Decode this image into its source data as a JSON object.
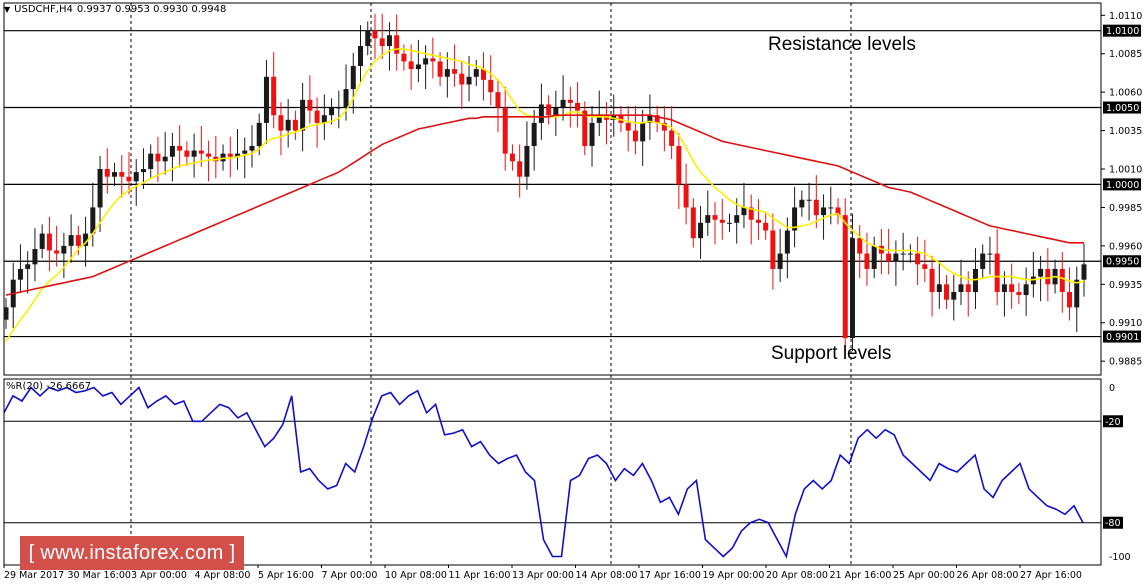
{
  "header": {
    "symbol": "USDCHF,H4",
    "ohlc": "0.9937 0.9953 0.9930 0.9948"
  },
  "annotations": {
    "resistance": "Resistance levels",
    "support": "Support levels"
  },
  "watermark": "[ www.instaforex.com ]",
  "colors": {
    "bull": "#1a1a1a",
    "bear": "#ee1111",
    "fast_ma": "#ffee00",
    "slow_ma": "#dd1111",
    "wpr": "#1010c8",
    "level_line": "#000000",
    "grid": "#000000"
  },
  "chart_data": [
    {
      "type": "candlestick",
      "title": "USDCHF,H4",
      "ylim": [
        0.9876,
        1.0118
      ],
      "y_ticks": [
        "1.0110",
        "1.0085",
        "1.0060",
        "1.0035",
        "1.0010",
        "0.9985",
        "0.9960",
        "0.9935",
        "0.9910",
        "0.9885"
      ],
      "levels": [
        {
          "label": "1.0100",
          "value": 1.01
        },
        {
          "label": "1.0050",
          "value": 1.005
        },
        {
          "label": "1.0000",
          "value": 1.0
        },
        {
          "label": "0.9950",
          "value": 0.995
        },
        {
          "label": "0.9901",
          "value": 0.9901
        }
      ],
      "x_labels": [
        "29 Mar 2017",
        "30 Mar 16:00",
        "3 Apr 00:00",
        "4 Apr 08:00",
        "5 Apr 16:00",
        "7 Apr 00:00",
        "10 Apr 08:00",
        "11 Apr 16:00",
        "13 Apr 00:00",
        "14 Apr 08:00",
        "17 Apr 16:00",
        "19 Apr 00:00",
        "20 Apr 08:00",
        "21 Apr 16:00",
        "25 Apr 00:00",
        "26 Apr 08:00",
        "27 Apr 16:00"
      ],
      "close": [
        0.992,
        0.9938,
        0.9945,
        0.9948,
        0.9958,
        0.9968,
        0.9957,
        0.9955,
        0.996,
        0.9967,
        0.996,
        0.9968,
        0.9985,
        1.001,
        1.0005,
        1.0008,
        1.0005,
        1.0002,
        1.0008,
        1.001,
        1.002,
        1.0015,
        1.0018,
        1.0025,
        1.0022,
        1.0018,
        1.0022,
        1.002,
        1.0018,
        1.0015,
        1.002,
        1.0018,
        1.002,
        1.0022,
        1.0025,
        1.004,
        1.007,
        1.0045,
        1.0035,
        1.0042,
        1.0035,
        1.0055,
        1.0048,
        1.004,
        1.0045,
        1.005,
        1.005,
        1.0062,
        1.0077,
        1.009,
        1.01,
        1.0095,
        1.009,
        1.0097,
        1.0085,
        1.008,
        1.0075,
        1.0078,
        1.0082,
        1.008,
        1.007,
        1.0075,
        1.0072,
        1.0065,
        1.007,
        1.0075,
        1.0068,
        1.006,
        1.005,
        1.002,
        1.0015,
        1.0005,
        1.0025,
        1.004,
        1.0052,
        1.0045,
        1.005,
        1.0055,
        1.0053,
        1.0048,
        1.0025,
        1.004,
        1.0045,
        1.0042,
        1.0045,
        1.004,
        1.0035,
        1.0028,
        1.004,
        1.0045,
        1.004,
        1.0035,
        1.0025,
        1.0,
        0.9985,
        0.9965,
        0.9975,
        0.998,
        0.9977,
        0.9975,
        0.9975,
        0.998,
        0.9985,
        0.9977,
        0.9975,
        0.997,
        0.9945,
        0.9955,
        0.997,
        0.9985,
        0.999,
        0.999,
        0.998,
        0.9985,
        0.9985,
        0.998,
        0.99,
        0.9965,
        0.9955,
        0.9945,
        0.996,
        0.9955,
        0.995,
        0.9955,
        0.9955,
        0.9955,
        0.9948,
        0.9945,
        0.993,
        0.9935,
        0.9925,
        0.993,
        0.9935,
        0.993,
        0.9945,
        0.9955,
        0.9955,
        0.993,
        0.9935,
        0.993,
        0.9928,
        0.9935,
        0.994,
        0.9945,
        0.9935,
        0.9945,
        0.993,
        0.992,
        0.9938,
        0.9948
      ],
      "series": [
        {
          "name": "",
          "type": "line",
          "role": "fast_ma",
          "values": [
            0.9898,
            0.9905,
            0.9912,
            0.9918,
            0.9925,
            0.9932,
            0.9937,
            0.9941,
            0.9946,
            0.9952,
            0.9958,
            0.9962,
            0.9968,
            0.9975,
            0.9982,
            0.9988,
            0.9993,
            0.9996,
            0.9999,
            1.0001,
            1.0004,
            1.0006,
            1.0008,
            1.001,
            1.0012,
            1.0013,
            1.0014,
            1.0015,
            1.0016,
            1.0016,
            1.0017,
            1.0017,
            1.0018,
            1.0019,
            1.002,
            1.0023,
            1.0028,
            1.003,
            1.0031,
            1.0033,
            1.0034,
            1.0036,
            1.0038,
            1.0039,
            1.004,
            1.0041,
            1.0043,
            1.0048,
            1.0056,
            1.0066,
            1.0074,
            1.008,
            1.0084,
            1.0087,
            1.0088,
            1.0088,
            1.0087,
            1.0086,
            1.0085,
            1.0084,
            1.0083,
            1.0082,
            1.0081,
            1.008,
            1.0078,
            1.0077,
            1.0075,
            1.0072,
            1.0068,
            1.0062,
            1.0055,
            1.0048,
            1.0045,
            1.0044,
            1.0044,
            1.0044,
            1.0044,
            1.0045,
            1.0047,
            1.0047,
            1.0045,
            1.0044,
            1.0044,
            1.0044,
            1.0043,
            1.0042,
            1.0041,
            1.004,
            1.004,
            1.0041,
            1.004,
            1.0039,
            1.0037,
            1.0032,
            1.0024,
            1.0015,
            1.0008,
            1.0003,
            0.9998,
            0.9994,
            0.999,
            0.9987,
            0.9985,
            0.9984,
            0.9983,
            0.9982,
            0.9978,
            0.9975,
            0.9972,
            0.9972,
            0.9973,
            0.9974,
            0.9976,
            0.9978,
            0.998,
            0.9981,
            0.9975,
            0.997,
            0.9966,
            0.9962,
            0.996,
            0.9958,
            0.9957,
            0.9957,
            0.9957,
            0.9957,
            0.9956,
            0.9955,
            0.9952,
            0.9949,
            0.9945,
            0.9942,
            0.994,
            0.9938,
            0.9938,
            0.9939,
            0.994,
            0.994,
            0.994,
            0.994,
            0.9939,
            0.9938,
            0.9938,
            0.9939,
            0.9939,
            0.994,
            0.9939,
            0.9937,
            0.9936,
            0.9937
          ]
        },
        {
          "name": "",
          "type": "line",
          "role": "slow_ma",
          "values": [
            0.9928,
            0.9929,
            0.993,
            0.9931,
            0.9932,
            0.9933,
            0.9934,
            0.9935,
            0.9936,
            0.9937,
            0.9938,
            0.9939,
            0.994,
            0.9942,
            0.9944,
            0.9946,
            0.9948,
            0.995,
            0.9952,
            0.9954,
            0.9956,
            0.9958,
            0.996,
            0.9962,
            0.9964,
            0.9966,
            0.9968,
            0.997,
            0.9972,
            0.9974,
            0.9976,
            0.9978,
            0.998,
            0.9982,
            0.9984,
            0.9986,
            0.9988,
            0.999,
            0.9992,
            0.9994,
            0.9996,
            0.9998,
            1.0,
            1.0002,
            1.0004,
            1.0006,
            1.0008,
            1.0011,
            1.0014,
            1.0017,
            1.002,
            1.0023,
            1.0026,
            1.0028,
            1.003,
            1.0032,
            1.0034,
            1.0036,
            1.0037,
            1.0038,
            1.0039,
            1.004,
            1.0041,
            1.0042,
            1.0043,
            1.0043,
            1.0044,
            1.0044,
            1.0044,
            1.0044,
            1.0044,
            1.0044,
            1.0044,
            1.0044,
            1.0044,
            1.0044,
            1.0045,
            1.0045,
            1.0045,
            1.0045,
            1.0045,
            1.0045,
            1.0045,
            1.0045,
            1.0045,
            1.0045,
            1.0045,
            1.0045,
            1.0045,
            1.0045,
            1.0044,
            1.0043,
            1.0042,
            1.004,
            1.0038,
            1.0036,
            1.0034,
            1.0032,
            1.003,
            1.0028,
            1.0027,
            1.0026,
            1.0025,
            1.0024,
            1.0023,
            1.0022,
            1.0021,
            1.002,
            1.0019,
            1.0018,
            1.0017,
            1.0016,
            1.0015,
            1.0014,
            1.0013,
            1.0012,
            1.001,
            1.0008,
            1.0006,
            1.0004,
            1.0002,
            1.0,
            0.9998,
            0.9997,
            0.9996,
            0.9995,
            0.9993,
            0.9991,
            0.9989,
            0.9987,
            0.9985,
            0.9983,
            0.9981,
            0.9979,
            0.9977,
            0.9975,
            0.9973,
            0.9972,
            0.9971,
            0.997,
            0.9969,
            0.9968,
            0.9967,
            0.9966,
            0.9965,
            0.9964,
            0.9963,
            0.9962,
            0.9962,
            0.9962
          ]
        }
      ]
    },
    {
      "type": "line",
      "title": "%R(20) -26.6667",
      "ylim": [
        -105,
        5
      ],
      "y_ticks": [
        "0",
        "-20",
        "-80",
        "-100"
      ],
      "levels": [
        {
          "label": "-20",
          "value": -20
        },
        {
          "label": "-80",
          "value": -80
        }
      ],
      "series": [
        {
          "name": "%R(20)",
          "values": [
            -15,
            -5,
            -8,
            0,
            -5,
            0,
            -2,
            0,
            -3,
            -2,
            0,
            -5,
            -3,
            -10,
            -5,
            0,
            -12,
            -8,
            -5,
            -10,
            -8,
            -20,
            -20,
            -15,
            -10,
            -12,
            -18,
            -15,
            -25,
            -35,
            -30,
            -22,
            -5,
            -50,
            -48,
            -55,
            -60,
            -58,
            -45,
            -50,
            -35,
            -18,
            -5,
            -3,
            -10,
            -5,
            -2,
            -15,
            -10,
            -28,
            -27,
            -25,
            -35,
            -32,
            -40,
            -45,
            -42,
            -40,
            -50,
            -55,
            -90,
            -100,
            -100,
            -55,
            -52,
            -42,
            -40,
            -45,
            -55,
            -48,
            -52,
            -45,
            -55,
            -68,
            -65,
            -75,
            -60,
            -55,
            -90,
            -95,
            -100,
            -95,
            -85,
            -80,
            -78,
            -80,
            -90,
            -100,
            -75,
            -60,
            -55,
            -60,
            -55,
            -40,
            -45,
            -30,
            -25,
            -30,
            -25,
            -28,
            -40,
            -45,
            -50,
            -55,
            -45,
            -48,
            -50,
            -45,
            -40,
            -60,
            -65,
            -55,
            -50,
            -45,
            -60,
            -65,
            -70,
            -72,
            -75,
            -70,
            -80
          ]
        }
      ]
    }
  ]
}
